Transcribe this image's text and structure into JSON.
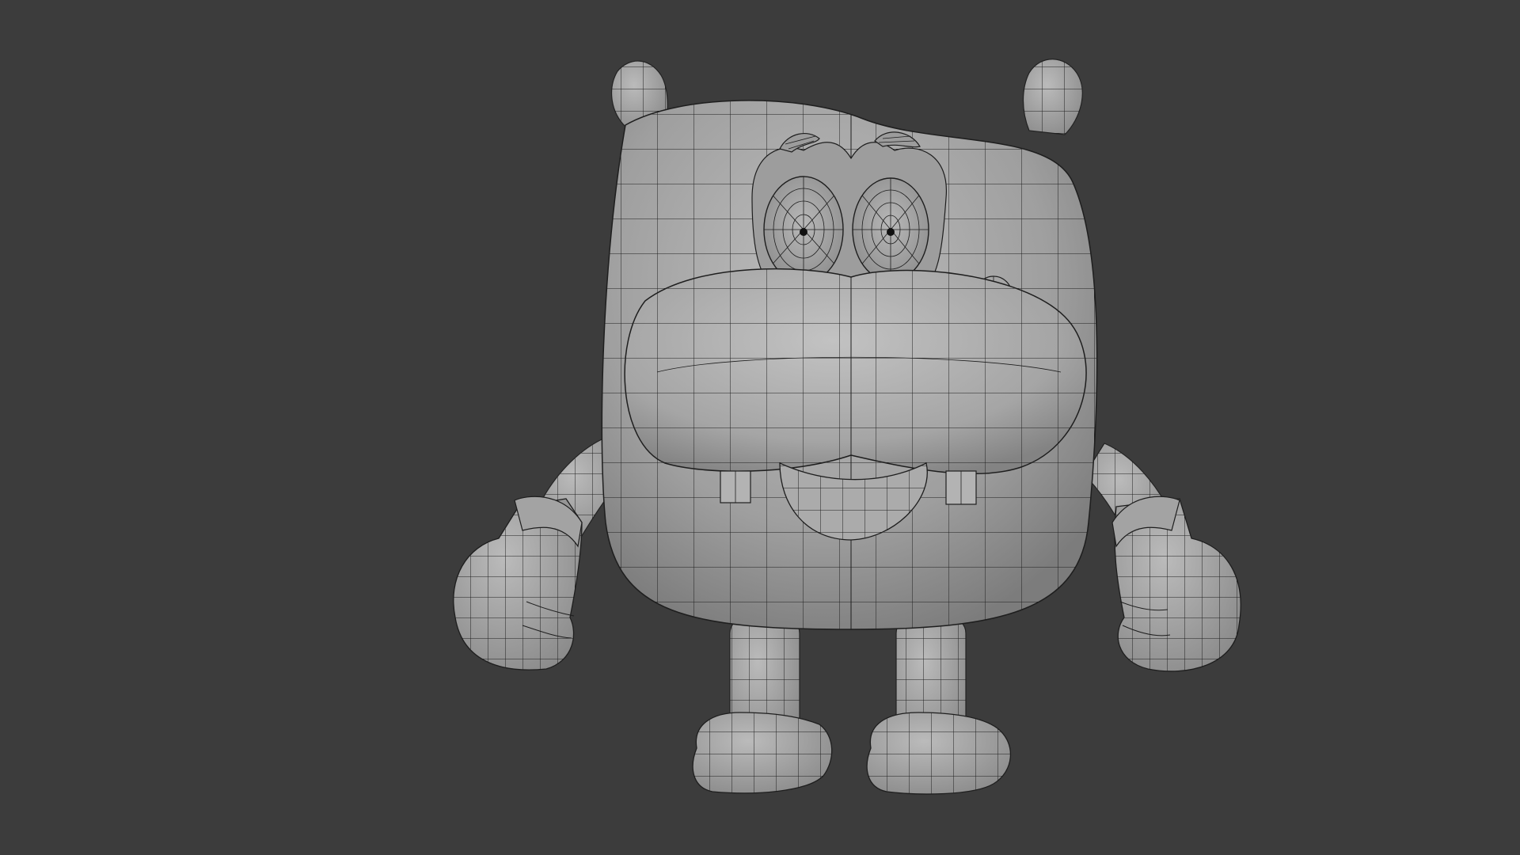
{
  "viewport": {
    "background": "#3c3c3c",
    "shading": "solid",
    "overlay": "wireframe"
  },
  "model": {
    "subject": "hippo-character-mesh",
    "mesh_color": "#a3a3a3",
    "wire_color": "#1e1e1e"
  }
}
